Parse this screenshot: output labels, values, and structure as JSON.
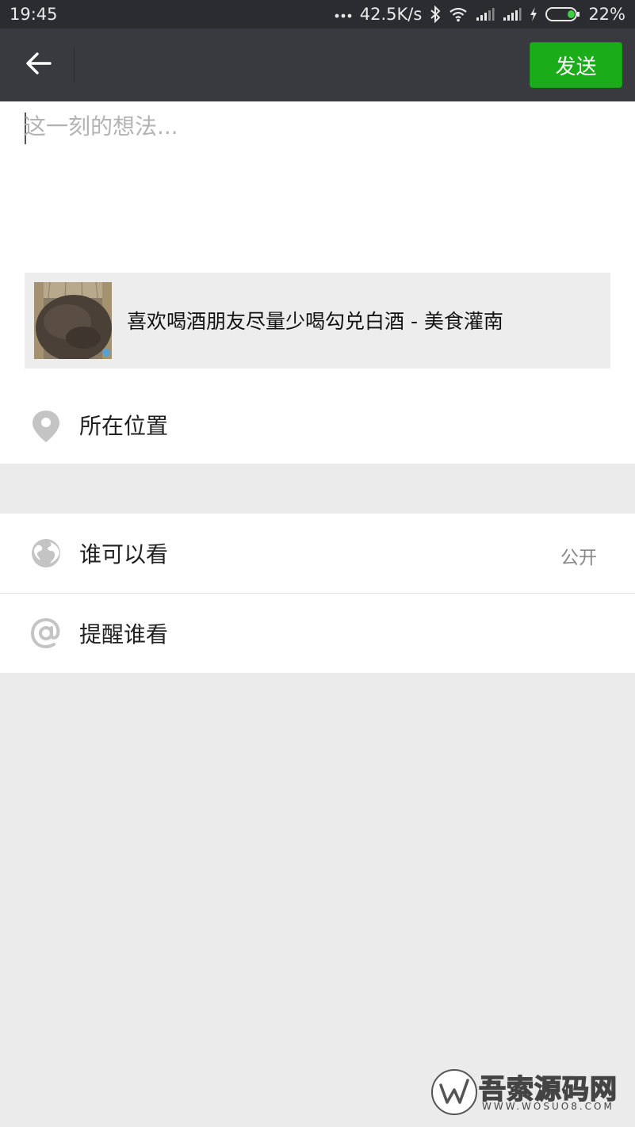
{
  "status_bar": {
    "time": "19:45",
    "network_speed": "42.5K/s",
    "battery": "22%",
    "icons": [
      "more-dots-icon",
      "bluetooth-icon",
      "wifi-icon",
      "signal-icon",
      "signal-icon",
      "charging-icon",
      "battery-icon"
    ]
  },
  "top_bar": {
    "back_icon": "arrow-left-icon",
    "send_label": "发送"
  },
  "compose": {
    "placeholder": "这一刻的想法..."
  },
  "share_card": {
    "title": "喜欢喝酒朋友尽量少喝勾兑白酒 - 美食灌南",
    "thumbnail": "wooden-vat-image"
  },
  "rows": {
    "location": {
      "label": "所在位置",
      "icon": "location-pin-icon"
    },
    "visibility": {
      "label": "谁可以看",
      "value": "公开",
      "icon": "globe-icon"
    },
    "remind": {
      "label": "提醒谁看",
      "icon": "at-sign-icon"
    }
  },
  "watermark": {
    "text": "吾索源码网",
    "url": "WWW.WOSUO8.COM"
  },
  "colors": {
    "status_bar": "#2b2c30",
    "top_bar": "#393a3f",
    "send_button": "#1aad19",
    "page_background": "#ebebeb"
  }
}
